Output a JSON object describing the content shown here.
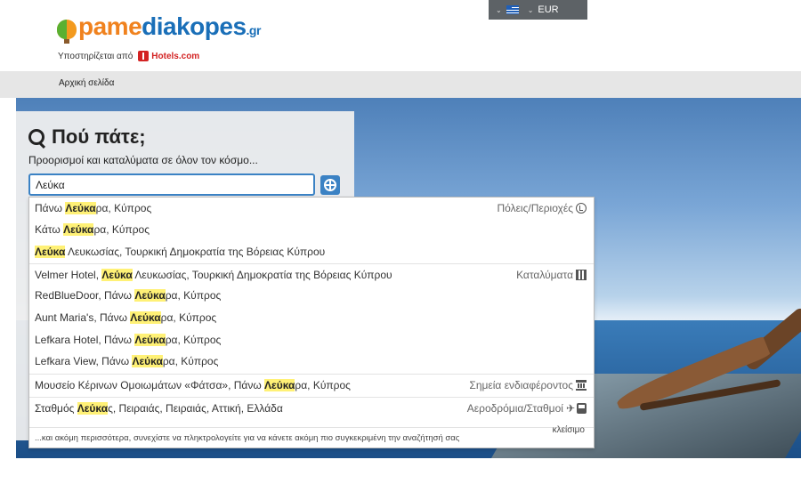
{
  "header": {
    "logo_part1": "pame",
    "logo_part2": "diakopes",
    "logo_suffix": ".gr",
    "powered_by": "Υποστηρίζεται από",
    "partner": "Hotels.com",
    "currency": "EUR",
    "language_flag": "greek-flag-icon"
  },
  "nav": {
    "home": "Αρχική σελίδα"
  },
  "search": {
    "title": "Πού πάτε;",
    "subtitle": "Προορισμοί και καταλύματα σε όλον τον κόσμο...",
    "input_value": "Λεύκα",
    "accent_color": "#3b82c4"
  },
  "dropdown": {
    "rows": [
      {
        "pre": "Πάνω ",
        "hl": "Λεύκα",
        "post": "ρα, Κύπρος",
        "category": "Πόλεις/Περιοχές",
        "icon": "city-icon"
      },
      {
        "pre": "Κάτω ",
        "hl": "Λεύκα",
        "post": "ρα, Κύπρος",
        "category": "",
        "icon": ""
      },
      {
        "pre": "",
        "hl": "Λεύκα",
        "post": " Λευκωσίας, Τουρκική Δημοκρατία της Βόρειας Κύπρου",
        "category": "",
        "icon": ""
      },
      {
        "pre": "Velmer Hotel, ",
        "hl": "Λεύκα",
        "post": " Λευκωσίας, Τουρκική Δημοκρατία της Βόρειας Κύπρου",
        "category": "Καταλύματα",
        "icon": "hotel-icon"
      },
      {
        "pre": "RedBlueDoor, Πάνω ",
        "hl": "Λεύκα",
        "post": "ρα, Κύπρος",
        "category": "",
        "icon": ""
      },
      {
        "pre": "Aunt Maria's, Πάνω ",
        "hl": "Λεύκα",
        "post": "ρα, Κύπρος",
        "category": "",
        "icon": ""
      },
      {
        "pre": "Lefkara Hotel, Πάνω ",
        "hl": "Λεύκα",
        "post": "ρα, Κύπρος",
        "category": "",
        "icon": ""
      },
      {
        "pre": "Lefkara View, Πάνω ",
        "hl": "Λεύκα",
        "post": "ρα, Κύπρος",
        "category": "",
        "icon": ""
      },
      {
        "pre": "Μουσείο Κέρινων Ομοιωμάτων «Φάτσα», Πάνω ",
        "hl": "Λεύκα",
        "post": "ρα, Κύπρος",
        "category": "Σημεία ενδιαφέροντος",
        "icon": "landmark-icon"
      },
      {
        "pre": "Σταθμός ",
        "hl": "Λεύκα",
        "post": "ς, Πειραιάς, Πειραιάς, Αττική, Ελλάδα",
        "category": "Αεροδρόμια/Σταθμοί",
        "icon": "plane-bus-icon"
      }
    ],
    "footer": "...και ακόμη περισσότερα, συνεχίστε να πληκτρολογείτε για να κάνετε ακόμη πιο συγκεκριμένη την αναζήτησή σας",
    "close": "κλείσιμο",
    "highlight_color": "#fff176"
  }
}
